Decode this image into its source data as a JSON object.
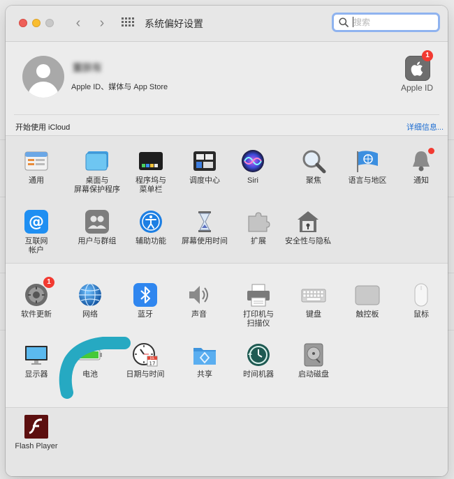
{
  "window": {
    "title": "系统偏好设置"
  },
  "nav": {
    "back": "‹",
    "forward": "›"
  },
  "search": {
    "placeholder": "搜索",
    "value": ""
  },
  "account": {
    "name": "董朕有",
    "subtitle": "Apple ID、媒体与 App Store",
    "apple_id_label": "Apple ID",
    "apple_id_badge": "1"
  },
  "icloud": {
    "prompt": "开始使用 iCloud",
    "details_link": "详细信息..."
  },
  "sections": [
    {
      "items": [
        {
          "label": "通用",
          "icon": "general-icon"
        },
        {
          "label": "桌面与\n屏幕保护程序",
          "icon": "desktop-screensaver-icon"
        },
        {
          "label": "程序坞与\n菜单栏",
          "icon": "dock-menubar-icon"
        },
        {
          "label": "调度中心",
          "icon": "mission-control-icon"
        },
        {
          "label": "Siri",
          "icon": "siri-icon"
        },
        {
          "label": "聚焦",
          "icon": "spotlight-icon"
        },
        {
          "label": "语言与地区",
          "icon": "language-region-icon"
        },
        {
          "label": "通知",
          "icon": "notifications-icon"
        },
        {
          "label": "互联网\n帐户",
          "icon": "internet-accounts-icon"
        },
        {
          "label": "用户与群组",
          "icon": "users-groups-icon"
        },
        {
          "label": "辅助功能",
          "icon": "accessibility-icon"
        },
        {
          "label": "屏幕使用时间",
          "icon": "screen-time-icon"
        },
        {
          "label": "扩展",
          "icon": "extensions-icon"
        },
        {
          "label": "安全性与隐私",
          "icon": "security-privacy-icon"
        }
      ]
    },
    {
      "items": [
        {
          "label": "软件更新",
          "icon": "software-update-icon",
          "badge": "1"
        },
        {
          "label": "网络",
          "icon": "network-icon"
        },
        {
          "label": "蓝牙",
          "icon": "bluetooth-icon"
        },
        {
          "label": "声音",
          "icon": "sound-icon"
        },
        {
          "label": "打印机与\n扫描仪",
          "icon": "printer-scanner-icon"
        },
        {
          "label": "键盘",
          "icon": "keyboard-icon"
        },
        {
          "label": "触控板",
          "icon": "trackpad-icon"
        },
        {
          "label": "鼠标",
          "icon": "mouse-icon"
        },
        {
          "label": "显示器",
          "icon": "displays-icon"
        },
        {
          "label": "电池",
          "icon": "battery-icon"
        },
        {
          "label": "日期与时间",
          "icon": "date-time-icon"
        },
        {
          "label": "共享",
          "icon": "sharing-icon"
        },
        {
          "label": "时间机器",
          "icon": "time-machine-icon"
        },
        {
          "label": "启动磁盘",
          "icon": "startup-disk-icon"
        }
      ]
    },
    {
      "items": [
        {
          "label": "Flash Player",
          "icon": "flash-player-icon"
        }
      ]
    }
  ],
  "calendar_icon_text": {
    "month": "JUL",
    "day": "17"
  }
}
